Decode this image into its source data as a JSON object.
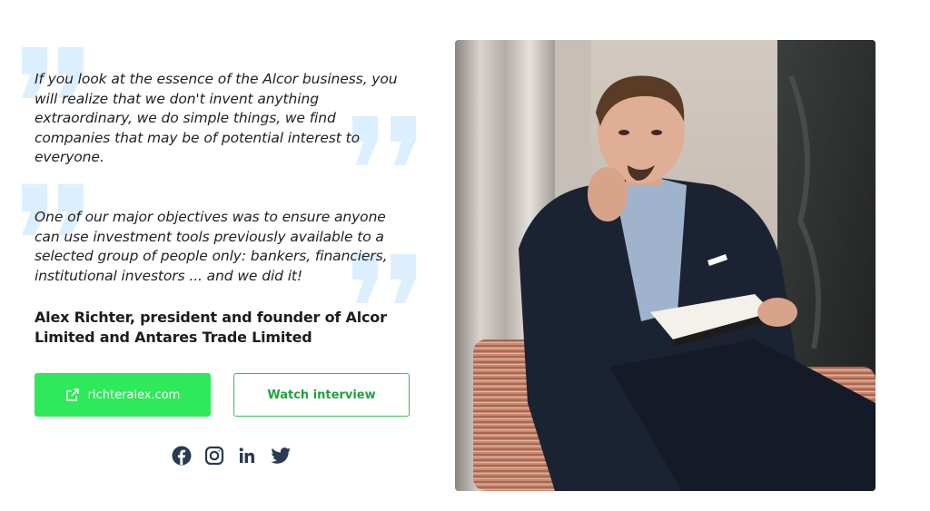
{
  "quotes": [
    {
      "text": "If you look at the essence of the Alcor business, you will realize that we don't invent anything extraordinary, we do simple things, we find companies that may be of potential interest to everyone."
    },
    {
      "text": "One of our major objectives was to ensure anyone can use investment tools previously available to a selected group of people only: bankers, financiers, institutional investors ... and we did it!"
    }
  ],
  "author": "Alex Richter, president and founder of Alcor Limited and Antares Trade Limited",
  "buttons": {
    "website_label": "richteralex.com",
    "interview_label": "Watch interview"
  },
  "social": [
    "facebook-icon",
    "instagram-icon",
    "linkedin-icon",
    "twitter-icon"
  ],
  "colors": {
    "accent_green": "#2ee95a",
    "outline_green": "#2fc154",
    "quote_mark": "#dcefff",
    "social_icon": "#2a3a52"
  }
}
